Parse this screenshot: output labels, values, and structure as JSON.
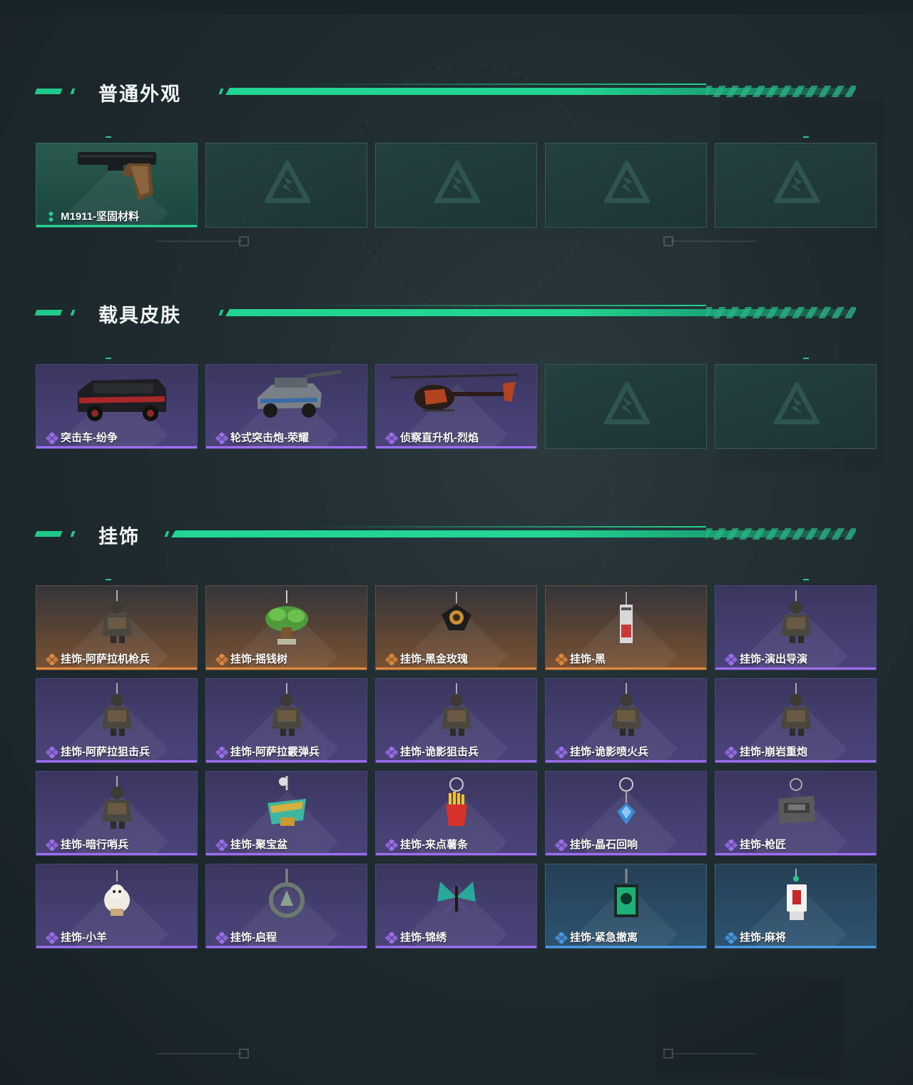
{
  "sections": [
    {
      "title": "普通外观",
      "items": [
        {
          "name": "M1911-坚固材料",
          "rarity": "green",
          "image": "pistol-m1911"
        },
        {
          "name": "",
          "rarity": "empty"
        },
        {
          "name": "",
          "rarity": "empty"
        },
        {
          "name": "",
          "rarity": "empty"
        },
        {
          "name": "",
          "rarity": "empty"
        }
      ]
    },
    {
      "title": "载具皮肤",
      "items": [
        {
          "name": "突击车-纷争",
          "rarity": "purple",
          "image": "assault-vehicle"
        },
        {
          "name": "轮式突击炮-荣耀",
          "rarity": "purple",
          "image": "wheeled-assault-gun"
        },
        {
          "name": "侦察直升机-烈焰",
          "rarity": "purple",
          "image": "scout-helicopter"
        },
        {
          "name": "",
          "rarity": "empty"
        },
        {
          "name": "",
          "rarity": "empty"
        }
      ]
    },
    {
      "title": "挂饰",
      "items": [
        {
          "name": "挂饰-阿萨拉机枪兵",
          "rarity": "orange",
          "image": "charm-figure"
        },
        {
          "name": "挂饰-摇钱树",
          "rarity": "orange",
          "image": "charm-money-tree"
        },
        {
          "name": "挂饰-黑金玫瑰",
          "rarity": "orange",
          "image": "charm-rose"
        },
        {
          "name": "挂饰-黑",
          "rarity": "orange",
          "image": "charm-tag"
        },
        {
          "name": "挂饰-演出导演",
          "rarity": "purple",
          "image": "charm-figure"
        },
        {
          "name": "挂饰-阿萨拉狙击兵",
          "rarity": "purple",
          "image": "charm-figure"
        },
        {
          "name": "挂饰-阿萨拉霰弹兵",
          "rarity": "purple",
          "image": "charm-figure"
        },
        {
          "name": "挂饰-诡影狙击兵",
          "rarity": "purple",
          "image": "charm-figure"
        },
        {
          "name": "挂饰-诡影喷火兵",
          "rarity": "purple",
          "image": "charm-figure"
        },
        {
          "name": "挂饰-崩岩重炮",
          "rarity": "purple",
          "image": "charm-figure"
        },
        {
          "name": "挂饰-暗行哨兵",
          "rarity": "purple",
          "image": "charm-figure"
        },
        {
          "name": "挂饰-聚宝盆",
          "rarity": "purple",
          "image": "charm-bowl"
        },
        {
          "name": "挂饰-来点薯条",
          "rarity": "purple",
          "image": "charm-fries"
        },
        {
          "name": "挂饰-晶石回响",
          "rarity": "purple",
          "image": "charm-crystal"
        },
        {
          "name": "挂饰-枪匠",
          "rarity": "purple",
          "image": "charm-box"
        },
        {
          "name": "挂饰-小羊",
          "rarity": "purple",
          "image": "charm-sheep"
        },
        {
          "name": "挂饰-启程",
          "rarity": "purple",
          "image": "charm-ring"
        },
        {
          "name": "挂饰-锦绣",
          "rarity": "purple",
          "image": "charm-butterfly"
        },
        {
          "name": "挂饰-紧急撤离",
          "rarity": "blue",
          "image": "charm-sign"
        },
        {
          "name": "挂饰-麻将",
          "rarity": "blue",
          "image": "charm-mahjong"
        }
      ]
    }
  ],
  "colors": {
    "accent": "#22d592",
    "green": "#22d592",
    "purple": "#9d6ff0",
    "orange": "#e0883c",
    "blue": "#4a98e8"
  },
  "icons": {
    "empty_slot": "triangle-logo-icon",
    "rarity": "diamond-cluster-icon"
  }
}
